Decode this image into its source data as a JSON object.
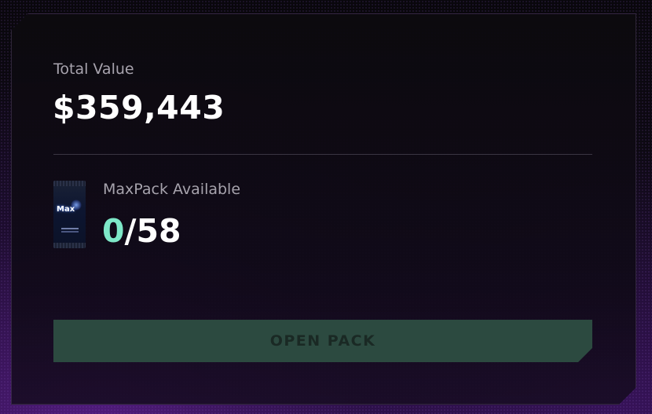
{
  "summary": {
    "total_label": "Total Value",
    "total_value": "$359,443"
  },
  "pack": {
    "thumbnail_text": "Max",
    "label": "MaxPack Available",
    "available": "0",
    "separator": "/",
    "total": "58"
  },
  "actions": {
    "open_label": "OPEN PACK",
    "open_state": "disabled"
  },
  "colors": {
    "accent": "#7ee8c8",
    "button_bg": "#2c4a40",
    "button_text": "#1a2924",
    "background_glow": "#6a1fb0"
  }
}
